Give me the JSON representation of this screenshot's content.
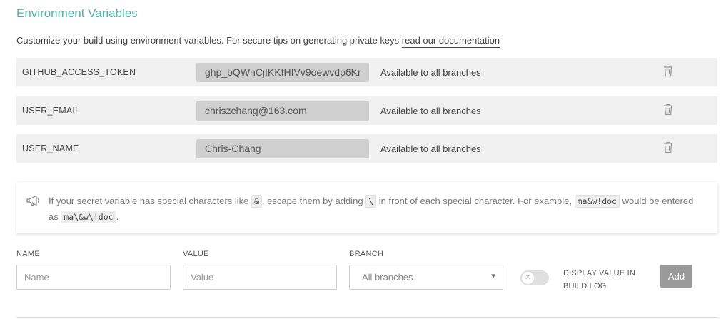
{
  "title": "Environment Variables",
  "description": {
    "text": "Customize your build using environment variables. For secure tips on generating private keys ",
    "link": "read our documentation"
  },
  "env_vars": [
    {
      "name": "GITHUB_ACCESS_TOKEN",
      "value": "ghp_bQWnCjIKKfHIVv9oewvdp6Kr",
      "branch": "Available to all branches"
    },
    {
      "name": "USER_EMAIL",
      "value": "chriszchang@163.com",
      "branch": "Available to all branches"
    },
    {
      "name": "USER_NAME",
      "value": "Chris-Chang",
      "branch": "Available to all branches"
    }
  ],
  "notice": {
    "t1": "If your secret variable has special characters like ",
    "c1": "&",
    "t2": ", escape them by adding ",
    "c2": "\\",
    "t3": " in front of each special character. For example, ",
    "c3": "ma&w!doc",
    "t4": " would be entered as ",
    "c4": "ma\\&w\\!doc",
    "t5": "."
  },
  "form": {
    "name_label": "NAME",
    "name_placeholder": "Name",
    "value_label": "VALUE",
    "value_placeholder": "Value",
    "branch_label": "BRANCH",
    "branch_selected": "All branches",
    "toggle_label": "DISPLAY VALUE IN BUILD LOG",
    "add_label": "Add"
  },
  "icons": {
    "trash": "trash-icon",
    "notice": "megaphone-icon",
    "select": "chevron-down-icon",
    "toggle": "x-icon"
  },
  "colors": {
    "accent": "#4fb3a9",
    "row_bg": "#f0f0f0",
    "value_bg": "#cfcfcf",
    "add_button": "#9a9a9a"
  }
}
